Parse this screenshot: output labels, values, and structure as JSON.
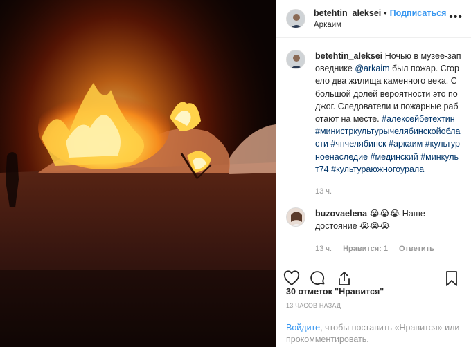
{
  "header": {
    "username": "betehtin_aleksei",
    "separator": "•",
    "follow_label": "Подписаться",
    "location": "Аркаим",
    "more_label": "•••"
  },
  "caption": {
    "username": "betehtin_aleksei",
    "text_before_mention": "Ночью в музее-заповеднике ",
    "mention": "@arkaim",
    "text_after_mention": " был пожар. Сгорело два жилища каменного века. С большой долей вероятности это поджог. Следователи и пожарные работают на месте.",
    "hashtags": [
      "#алексейбетехтин",
      "#министркультурычелябинскойобласти",
      "#чпчелябинск",
      "#аркаим",
      "#культурноенаследие",
      "#мединский",
      "#минкульт74",
      "#культураюжногоурала"
    ],
    "time": "13 ч."
  },
  "comment": {
    "username": "buzovaelena",
    "text": "😭😭😭 Наше достояние 😭😭😭",
    "time": "13 ч.",
    "likes_label": "Нравится: 1",
    "reply_label": "Ответить"
  },
  "actions": {
    "like_icon": "heart-icon",
    "comment_icon": "comment-icon",
    "share_icon": "share-icon",
    "save_icon": "bookmark-icon"
  },
  "likes": "30 отметок \"Нравится\"",
  "timestamp": "13 ЧАСОВ НАЗАД",
  "login_prompt": {
    "link": "Войдите",
    "text": ", чтобы поставить «Нравится» или прокомментировать."
  },
  "colors": {
    "link_blue": "#3897f0",
    "hashtag_blue": "#003569",
    "muted_gray": "#999999",
    "border": "#efefef"
  }
}
